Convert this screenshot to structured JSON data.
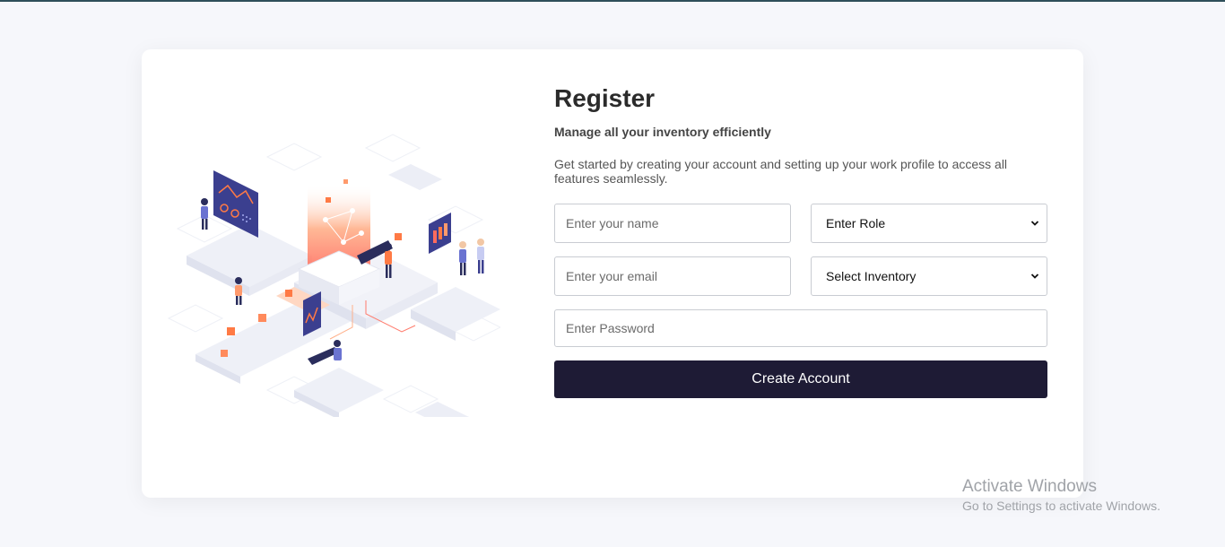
{
  "form": {
    "title": "Register",
    "subtitle": "Manage all your inventory efficiently",
    "description": "Get started by creating your account and setting up your work profile to access all features seamlessly.",
    "name_placeholder": "Enter your name",
    "role_selected": "Enter Role",
    "email_placeholder": "Enter your email",
    "inventory_selected": "Select Inventory",
    "password_placeholder": "Enter Password",
    "submit_label": "Create Account"
  },
  "watermark": {
    "line1": "Activate Windows",
    "line2": "Go to Settings to activate Windows."
  },
  "icons": {
    "illustration": "isometric-inventory-illustration",
    "select_arrow": "chevron-down-icon"
  },
  "colors": {
    "button": "#1e1b35",
    "background": "#f6f7fb",
    "accent_orange": "#ff7a45",
    "accent_navy": "#3b3f8f"
  }
}
